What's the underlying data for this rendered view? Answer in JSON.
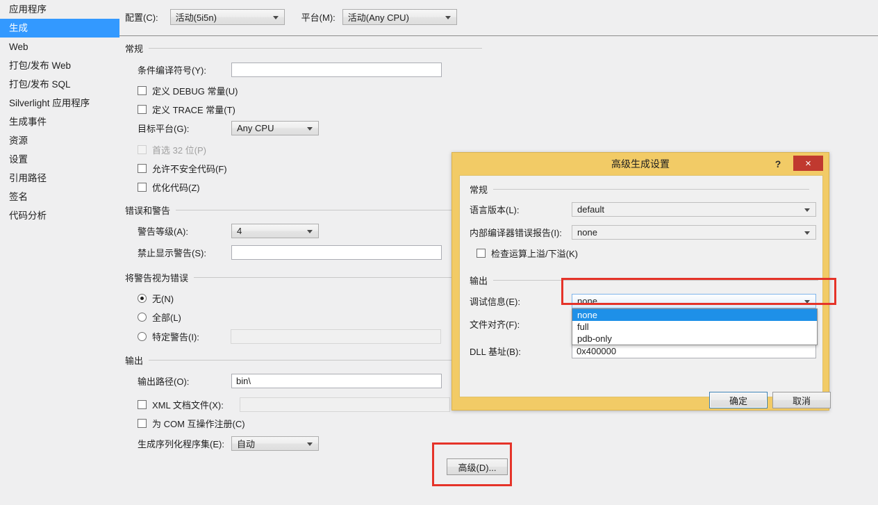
{
  "sidebar": {
    "items": [
      {
        "label": "应用程序",
        "selected": false
      },
      {
        "label": "生成",
        "selected": true
      },
      {
        "label": "Web",
        "selected": false
      },
      {
        "label": "打包/发布 Web",
        "selected": false
      },
      {
        "label": "打包/发布 SQL",
        "selected": false
      },
      {
        "label": "Silverlight 应用程序",
        "selected": false
      },
      {
        "label": "生成事件",
        "selected": false
      },
      {
        "label": "资源",
        "selected": false
      },
      {
        "label": "设置",
        "selected": false
      },
      {
        "label": "引用路径",
        "selected": false
      },
      {
        "label": "签名",
        "selected": false
      },
      {
        "label": "代码分析",
        "selected": false
      }
    ]
  },
  "topbar": {
    "configuration_label": "配置(C):",
    "configuration_value": "活动(5i5n)",
    "platform_label": "平台(M):",
    "platform_value": "活动(Any CPU)"
  },
  "general": {
    "group_title": "常规",
    "conditional_symbols_label": "条件编译符号(Y):",
    "conditional_symbols_value": "",
    "define_debug_label": "定义 DEBUG 常量(U)",
    "define_debug_checked": false,
    "define_trace_label": "定义 TRACE 常量(T)",
    "define_trace_checked": false,
    "target_platform_label": "目标平台(G):",
    "target_platform_value": "Any CPU",
    "prefer32_label": "首选 32 位(P)",
    "prefer32_checked": false,
    "allow_unsafe_label": "允许不安全代码(F)",
    "allow_unsafe_checked": false,
    "optimize_label": "优化代码(Z)",
    "optimize_checked": false
  },
  "errors": {
    "group_title": "错误和警告",
    "warning_level_label": "警告等级(A):",
    "warning_level_value": "4",
    "suppress_warnings_label": "禁止显示警告(S):",
    "suppress_warnings_value": "",
    "treat_group_title": "将警告视为错误",
    "radio_none_label": "无(N)",
    "radio_all_label": "全部(L)",
    "radio_specific_label": "特定警告(I):",
    "radio_selected": "none",
    "specific_warnings_value": ""
  },
  "output": {
    "group_title": "输出",
    "output_path_label": "输出路径(O):",
    "output_path_value": "bin\\",
    "xml_doc_label": "XML 文档文件(X):",
    "xml_doc_checked": false,
    "xml_doc_value": "",
    "register_com_label": "为 COM 互操作注册(C)",
    "register_com_checked": false,
    "serialization_label": "生成序列化程序集(E):",
    "serialization_value": "自动",
    "advanced_button_label": "高级(D)..."
  },
  "dialog": {
    "title": "高级生成设置",
    "help_icon": "?",
    "close_icon": "×",
    "general": {
      "group_title": "常规",
      "language_version_label": "语言版本(L):",
      "language_version_value": "default",
      "error_report_label": "内部编译器错误报告(I):",
      "error_report_value": "none",
      "check_overflow_label": "检查运算上溢/下溢(K)",
      "check_overflow_checked": false
    },
    "output": {
      "group_title": "输出",
      "debug_info_label": "调试信息(E):",
      "debug_info_value": "none",
      "debug_info_options": [
        "none",
        "full",
        "pdb-only"
      ],
      "debug_info_selected_index": 0,
      "file_align_label": "文件对齐(F):",
      "dll_base_label": "DLL 基址(B):",
      "dll_base_value": "0x400000"
    },
    "ok_button_label": "确定",
    "cancel_button_label": "取消"
  },
  "colors": {
    "sidebar_selected": "#3399ff",
    "dialog_title_bar": "#f2cb66",
    "dialog_close": "#c0392f",
    "dropdown_highlight": "#1e90e8",
    "annotation_red": "#e53329"
  }
}
